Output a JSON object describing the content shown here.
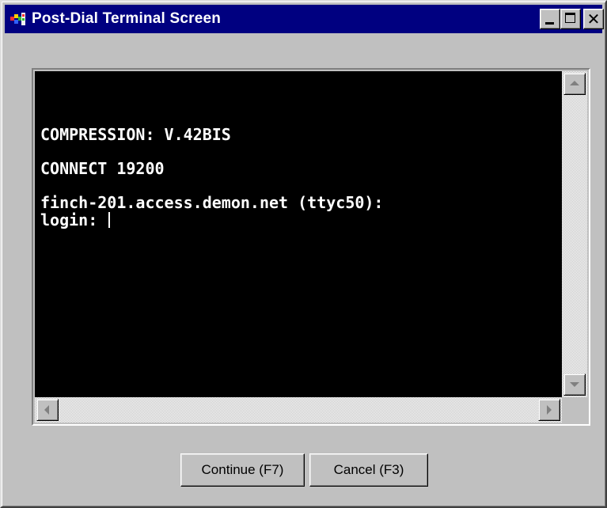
{
  "window": {
    "title": "Post-Dial Terminal Screen",
    "titlebar_color": "#000080",
    "face_color": "#c0c0c0",
    "controls": {
      "minimize_icon": "minimize-icon",
      "maximize_icon": "maximize-icon",
      "close_glyph": "✕"
    }
  },
  "terminal": {
    "background": "#000000",
    "text_color": "#ffffff",
    "lines": [
      "COMPRESSION: V.42BIS",
      "",
      "CONNECT 19200",
      "",
      "finch-201.access.demon.net (ttyc50):"
    ],
    "prompt": "login: "
  },
  "buttons": {
    "continue_label": "Continue (F7)",
    "cancel_label": "Cancel (F3)"
  }
}
